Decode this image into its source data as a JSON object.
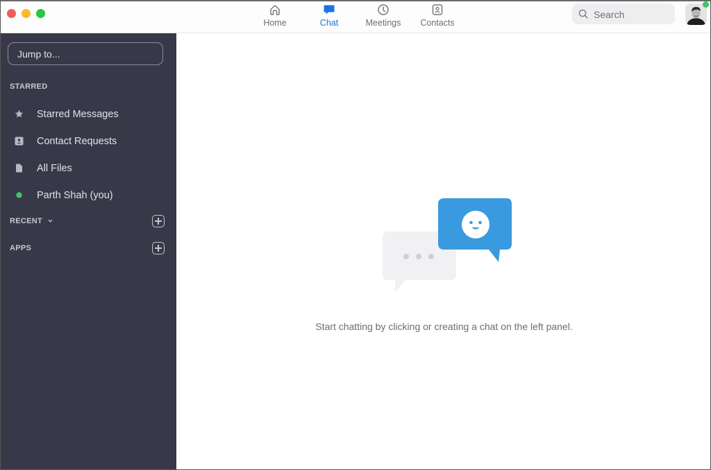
{
  "window": {
    "traffic_lights": [
      "close",
      "minimize",
      "zoom"
    ],
    "colors": {
      "close": "#f25b57",
      "minimize": "#f8b92c",
      "zoom": "#2ac541"
    }
  },
  "topnav": {
    "tabs": [
      {
        "label": "Home",
        "icon": "home-icon",
        "active": false
      },
      {
        "label": "Chat",
        "icon": "chat-icon",
        "active": true
      },
      {
        "label": "Meetings",
        "icon": "clock-icon",
        "active": false
      },
      {
        "label": "Contacts",
        "icon": "contact-card-icon",
        "active": false
      }
    ],
    "accent_color": "#1a73e8",
    "search": {
      "placeholder": "Search",
      "icon": "search-icon"
    },
    "profile": {
      "status": "online",
      "status_color": "#3cc466"
    }
  },
  "sidebar": {
    "jump_placeholder": "Jump to...",
    "starred_header": "STARRED",
    "items": [
      {
        "label": "Starred Messages",
        "icon": "star-icon"
      },
      {
        "label": "Contact Requests",
        "icon": "contact-request-icon"
      },
      {
        "label": "All Files",
        "icon": "file-icon"
      },
      {
        "label": "Parth Shah  (you)",
        "icon": "online-status-icon"
      }
    ],
    "recent_header": "RECENT",
    "apps_header": "APPS",
    "background_color": "#383848"
  },
  "main": {
    "empty_message": "Start chatting by clicking or creating a chat on the left panel.",
    "illustration": "chat-bubbles-illustration"
  }
}
